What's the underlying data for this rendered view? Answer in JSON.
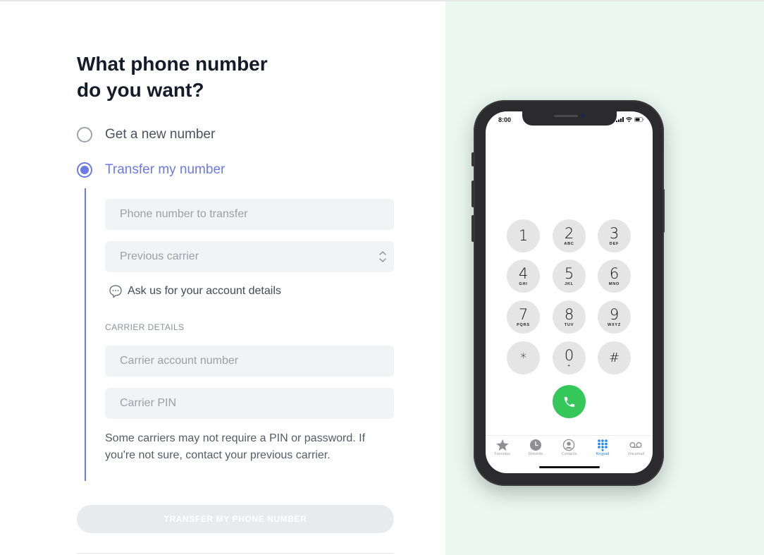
{
  "page": {
    "title": "What phone number do you want?",
    "title_line1": "What phone number",
    "title_line2": "do you want?"
  },
  "options": [
    {
      "label": "Get a new number",
      "selected": false
    },
    {
      "label": "Transfer my number",
      "selected": true
    }
  ],
  "form": {
    "phone_placeholder": "Phone number to transfer",
    "phone_value": "",
    "carrier_placeholder": "Previous carrier",
    "carrier_value": "",
    "ask_link": "Ask us for your account details",
    "section_label": "CARRIER DETAILS",
    "account_placeholder": "Carrier account number",
    "account_value": "",
    "pin_placeholder": "Carrier PIN",
    "pin_value": "",
    "helper_text": "Some carriers may not require a PIN or password. If you're not sure, contact your previous carrier.",
    "submit_label": "TRANSFER MY PHONE NUMBER",
    "submit_enabled": false
  },
  "colors": {
    "accent": "#6c7ae6",
    "right_panel_bg": "#ebf8f1",
    "call_green": "#35c759",
    "ios_blue": "#1a84ff"
  },
  "phone": {
    "status_time": "8:00",
    "keys": [
      {
        "digit": "1",
        "letters": ""
      },
      {
        "digit": "2",
        "letters": "ABC"
      },
      {
        "digit": "3",
        "letters": "DEF"
      },
      {
        "digit": "4",
        "letters": "GHI"
      },
      {
        "digit": "5",
        "letters": "JKL"
      },
      {
        "digit": "6",
        "letters": "MNO"
      },
      {
        "digit": "7",
        "letters": "PQRS"
      },
      {
        "digit": "8",
        "letters": "TUV"
      },
      {
        "digit": "9",
        "letters": "WXYZ"
      },
      {
        "digit": "*",
        "letters": ""
      },
      {
        "digit": "0",
        "letters": "+"
      },
      {
        "digit": "#",
        "letters": ""
      }
    ],
    "tabs": [
      {
        "label": "Favorites",
        "icon": "star-icon",
        "active": false
      },
      {
        "label": "Recents",
        "icon": "clock-icon",
        "active": false
      },
      {
        "label": "Contacts",
        "icon": "contact-icon",
        "active": false
      },
      {
        "label": "Keypad",
        "icon": "keypad-icon",
        "active": true
      },
      {
        "label": "Voicemail",
        "icon": "voicemail-icon",
        "active": false
      }
    ]
  }
}
